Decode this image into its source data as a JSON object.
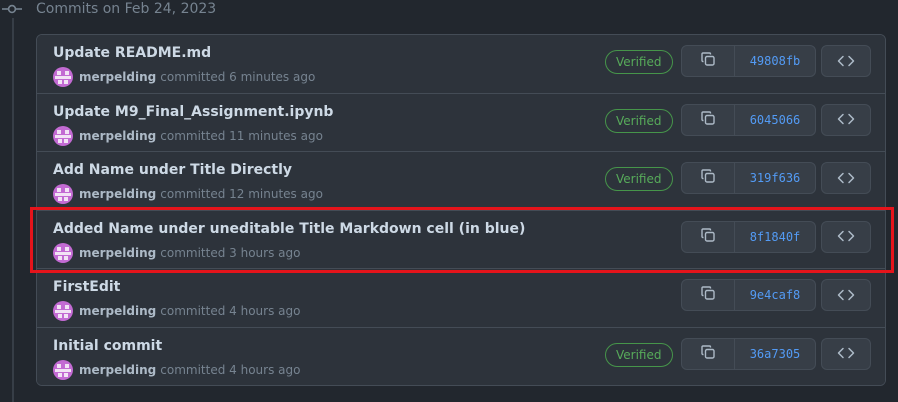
{
  "group": {
    "title": "Commits on Feb 24, 2023"
  },
  "commits": [
    {
      "message": "Update README.md",
      "author": "merpelding",
      "action": "committed",
      "time": "6 minutes ago",
      "verified": "Verified",
      "sha": "49808fb"
    },
    {
      "message": "Update M9_Final_Assignment.ipynb",
      "author": "merpelding",
      "action": "committed",
      "time": "11 minutes ago",
      "verified": "Verified",
      "sha": "6045066"
    },
    {
      "message": "Add Name under Title Directly",
      "author": "merpelding",
      "action": "committed",
      "time": "12 minutes ago",
      "verified": "Verified",
      "sha": "319f636"
    },
    {
      "message": "Added Name under uneditable Title Markdown cell (in blue)",
      "author": "merpelding",
      "action": "committed",
      "time": "3 hours ago",
      "verified": null,
      "sha": "8f1840f",
      "highlighted": true
    },
    {
      "message": "FirstEdit",
      "author": "merpelding",
      "action": "committed",
      "time": "4 hours ago",
      "verified": null,
      "sha": "9e4caf8"
    },
    {
      "message": "Initial commit",
      "author": "merpelding",
      "action": "committed",
      "time": "4 hours ago",
      "verified": "Verified",
      "sha": "36a7305"
    }
  ],
  "icons": {
    "timeline": "git-commit-icon",
    "copy": "copy-icon",
    "browse": "code-icon"
  },
  "colors": {
    "background": "#22272e",
    "row": "#2d333b",
    "verified": "#57ab5a",
    "sha": "#539bf5",
    "highlight": "#e5141b",
    "avatar": "#c36bd3"
  }
}
